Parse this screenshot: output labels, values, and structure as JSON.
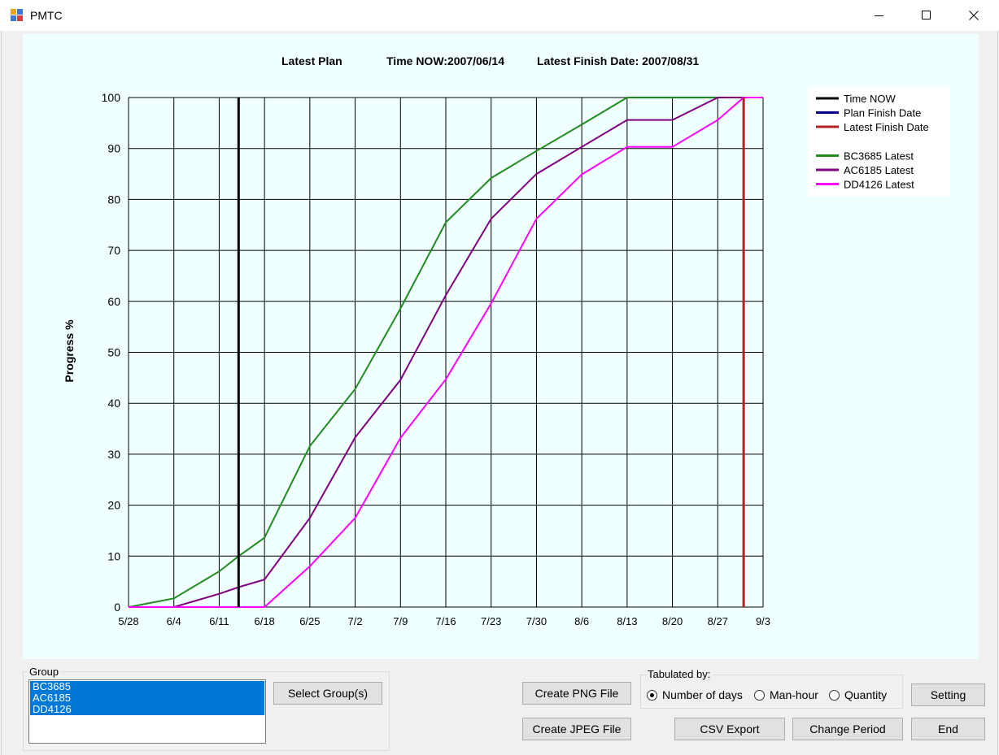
{
  "window": {
    "title": "PMTC",
    "icon": "app-window-icon"
  },
  "chart_header": {
    "plan_label": "Latest Plan",
    "time_now_text": "Time NOW:2007/06/14",
    "latest_finish_text": "Latest Finish Date: 2007/08/31"
  },
  "chart_data": {
    "type": "line",
    "ylabel": "Progress %",
    "ylim": [
      0,
      100
    ],
    "yticks": [
      0,
      10,
      20,
      30,
      40,
      50,
      60,
      70,
      80,
      90,
      100
    ],
    "x_tick_labels": [
      "5/28",
      "6/4",
      "6/11",
      "6/18",
      "6/25",
      "7/2",
      "7/9",
      "7/16",
      "7/23",
      "7/30",
      "8/6",
      "8/13",
      "8/20",
      "8/27",
      "9/3"
    ],
    "x": [
      "5/28",
      "6/4",
      "6/11",
      "6/14",
      "6/18",
      "6/25",
      "7/2",
      "7/9",
      "7/16",
      "7/23",
      "7/30",
      "8/6",
      "8/13",
      "8/20",
      "8/27",
      "8/31",
      "9/3"
    ],
    "grid": true,
    "legend_position": "top-right",
    "vertical_lines": [
      {
        "name": "Time NOW",
        "x": "6/14",
        "color": "#000000"
      },
      {
        "name": "Latest Finish Date",
        "x": "8/31",
        "color": "#b22222"
      }
    ],
    "legend": [
      {
        "name": "Time NOW",
        "color": "#000000"
      },
      {
        "name": "Plan Finish Date",
        "color": "#000080"
      },
      {
        "name": "Latest Finish Date",
        "color": "#b22222"
      },
      {
        "name": "BC3685 Latest",
        "color": "#228b22"
      },
      {
        "name": "AC6185 Latest",
        "color": "#800080"
      },
      {
        "name": "DD4126 Latest",
        "color": "#ff00ff"
      }
    ],
    "series": [
      {
        "name": "BC3685 Latest",
        "color": "#228b22",
        "values": [
          0,
          1.7,
          7,
          10,
          13.6,
          31.6,
          42.8,
          58.6,
          75.5,
          84.2,
          89.5,
          94.7,
          100,
          100,
          100,
          100,
          100
        ]
      },
      {
        "name": "AC6185 Latest",
        "color": "#800080",
        "values": [
          0,
          0,
          2.6,
          3.9,
          5.4,
          17.5,
          33.3,
          44.6,
          61.2,
          76.2,
          85,
          90.3,
          95.6,
          95.6,
          100,
          100,
          100
        ]
      },
      {
        "name": "DD4126 Latest",
        "color": "#ff00ff",
        "values": [
          0,
          0,
          0,
          0,
          0,
          8,
          17.5,
          33.2,
          44.7,
          59.6,
          76.2,
          84.9,
          90.3,
          90.3,
          95.6,
          100,
          100
        ]
      }
    ]
  },
  "group": {
    "label": "Group",
    "items": [
      "BC3685",
      "AC6185",
      "DD4126"
    ],
    "select_button": "Select Group(s)"
  },
  "buttons": {
    "create_png": "Create PNG File",
    "create_jpeg": "Create JPEG File",
    "csv_export": "CSV Export",
    "change_period": "Change Period",
    "setting": "Setting",
    "end": "End"
  },
  "tabulated": {
    "label": "Tabulated by:",
    "options": [
      "Number of days",
      "Man-hour",
      "Quantity"
    ],
    "selected": "Number of days"
  }
}
